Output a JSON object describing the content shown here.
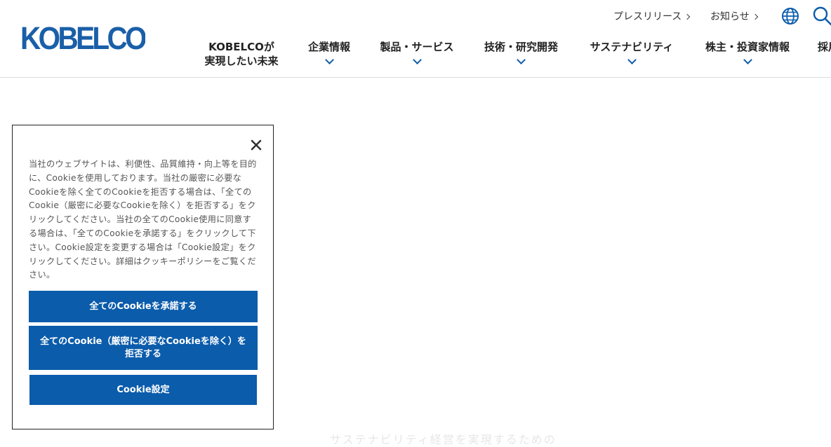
{
  "header": {
    "logo_text": "KOBELCO",
    "utility": {
      "press_label": "プレスリリース",
      "news_label": "お知らせ"
    },
    "nav": [
      {
        "line1": "KOBELCOが",
        "line2": "実現したい未来",
        "has_dropdown": false
      },
      {
        "line1": "企業情報",
        "line2": "",
        "has_dropdown": true
      },
      {
        "line1": "製品・サービス",
        "line2": "",
        "has_dropdown": true
      },
      {
        "line1": "技術・研究開発",
        "line2": "",
        "has_dropdown": true
      },
      {
        "line1": "サステナビリティ",
        "line2": "",
        "has_dropdown": true
      },
      {
        "line1": "株主・投資家情報",
        "line2": "",
        "has_dropdown": true
      },
      {
        "line1": "採用",
        "line2": "",
        "has_dropdown": false
      }
    ]
  },
  "colors": {
    "brand_blue": "#0b5cab",
    "logo_blue": "#1a5fa8"
  },
  "icons": {
    "globe": "globe-icon",
    "search": "search-icon",
    "close": "close-icon"
  },
  "background_text": "サステナビリティ経営を実現するための",
  "cookie_banner": {
    "body": "当社のウェブサイトは、利便性、品質維持・向上等を目的に、Cookieを使用しております。当社の厳密に必要なCookieを除く全てのCookieを拒否する場合は、「全てのCookie（厳密に必要なCookieを除く）を拒否する」をクリックしてください。当社の全てのCookie使用に同意する場合は、「全てのCookieを承諾する」をクリックして下さい。Cookie設定を変更する場合は「Cookie設定」をクリックしてください。詳細はクッキーポリシーをご覧ください。",
    "accept_all": "全てのCookieを承諾する",
    "reject_all": "全てのCookie（厳密に必要なCookieを除く）を拒否する",
    "settings": "Cookie設定"
  }
}
